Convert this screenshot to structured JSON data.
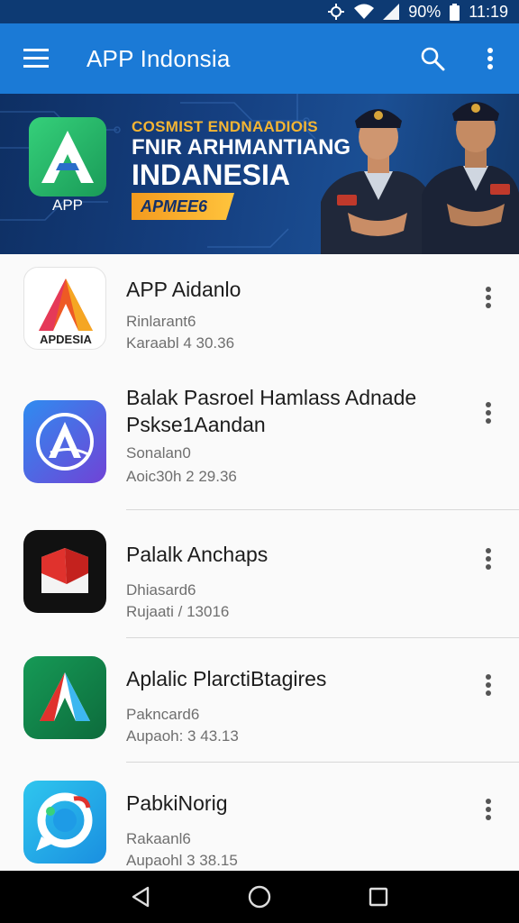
{
  "status_bar": {
    "battery": "90%",
    "time": "11:19"
  },
  "app_bar": {
    "title": "APP Indonsia"
  },
  "banner": {
    "logo_label": "APP",
    "line1": "COSMIST ENDNAADIOIS",
    "line2": "FNIR ARHMANTIANG",
    "line3": "INDANESIA",
    "badge": "APMEE6"
  },
  "apps": [
    {
      "icon": "apdesia-logo-icon",
      "icon_text": "APDESIA",
      "title": "APP Aidanlo",
      "line1": "Rinlarant6",
      "line2": "Karaabl 4 30.36"
    },
    {
      "icon": "blue-a-logo-icon",
      "title": "Balak Pasroel Hamlass Adnade Pskse1Aandan",
      "line1": "Sonalan0",
      "line2": "Aoic30h 2 29.36"
    },
    {
      "icon": "red-box-logo-icon",
      "title": "Palalk Anchaps",
      "line1": "Dhiasard6",
      "line2": "Rujaati / 13016"
    },
    {
      "icon": "green-a-logo-icon",
      "title": "Aplalic PlarctiBtagires",
      "line1": "Pakncard6",
      "line2": "Aupaoh: 3 43.13"
    },
    {
      "icon": "chat-bubble-logo-icon",
      "title": "PabkiNorig",
      "line1": "Rakaanl6",
      "line2": "Aupaohl 3 38.15"
    }
  ],
  "colors": {
    "status_bar": "#0d3a73",
    "app_bar": "#1b7ad6",
    "list_bg": "#fafafa",
    "nav_bar": "#000000"
  }
}
